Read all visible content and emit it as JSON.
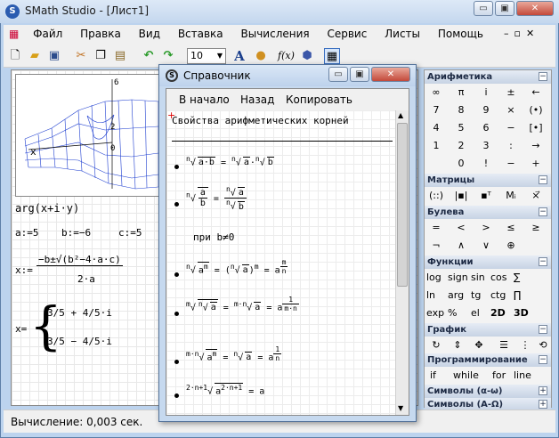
{
  "app": {
    "title": "SMath Studio - [Лист1]"
  },
  "menu": [
    "Файл",
    "Правка",
    "Вид",
    "Вставка",
    "Вычисления",
    "Сервис",
    "Листы",
    "Помощь"
  ],
  "toolbar": {
    "zoom": "10"
  },
  "status": {
    "text": "Вычисление: 0,003 сек."
  },
  "worksheet": {
    "arg_expr": "arg(x+i·y)",
    "vars": [
      "a:=5",
      "b:=−6",
      "c:=5"
    ],
    "quad_lhs": "x:=",
    "quad_num": "−b±√(b²−4·a·c)",
    "quad_den": "2·a",
    "result_lhs": "x=",
    "result_1": "3/5 + 4/5·i",
    "result_2": "3/5 − 4/5·i",
    "plot_axis_z": "6",
    "plot_axis_z2": "2",
    "plot_axis_z3": "0",
    "plot_axis_x": "x"
  },
  "reference": {
    "title": "Справочник",
    "nav_home": "В начало",
    "nav_back": "Назад",
    "nav_copy": "Копировать",
    "heading": "Свойства арифметических корней",
    "condition": "при   b≠0"
  },
  "panel": {
    "arithmetic": {
      "title": "Арифметика",
      "cells": [
        "∞",
        "π",
        "i",
        "±",
        "←",
        "7",
        "8",
        "9",
        "×",
        "(•)",
        "4",
        "5",
        "6",
        "−",
        "[•]",
        "1",
        "2",
        "3",
        ":",
        "→",
        "",
        "0",
        "!",
        "−",
        "+"
      ]
    },
    "matrices": {
      "title": "Матрицы"
    },
    "boolean": {
      "title": "Булева",
      "cells": [
        "=",
        "<",
        ">",
        "≤",
        "≥",
        "¬",
        "∧",
        "∨",
        "⊕"
      ]
    },
    "functions": {
      "title": "Функции",
      "rows": [
        [
          "log",
          "sign",
          "sin",
          "cos",
          "∑"
        ],
        [
          "ln",
          "arg",
          "tg",
          "ctg",
          "∏"
        ],
        [
          "exp",
          "%",
          "el",
          "2D",
          "3D"
        ]
      ]
    },
    "graph": {
      "title": "График"
    },
    "programming": {
      "title": "Программирование",
      "items": [
        "if",
        "while",
        "for",
        "line"
      ]
    },
    "symbols_greek": {
      "title": "Символы (α-ω)"
    },
    "symbols_latin": {
      "title": "Символы (Α-Ω)"
    }
  }
}
